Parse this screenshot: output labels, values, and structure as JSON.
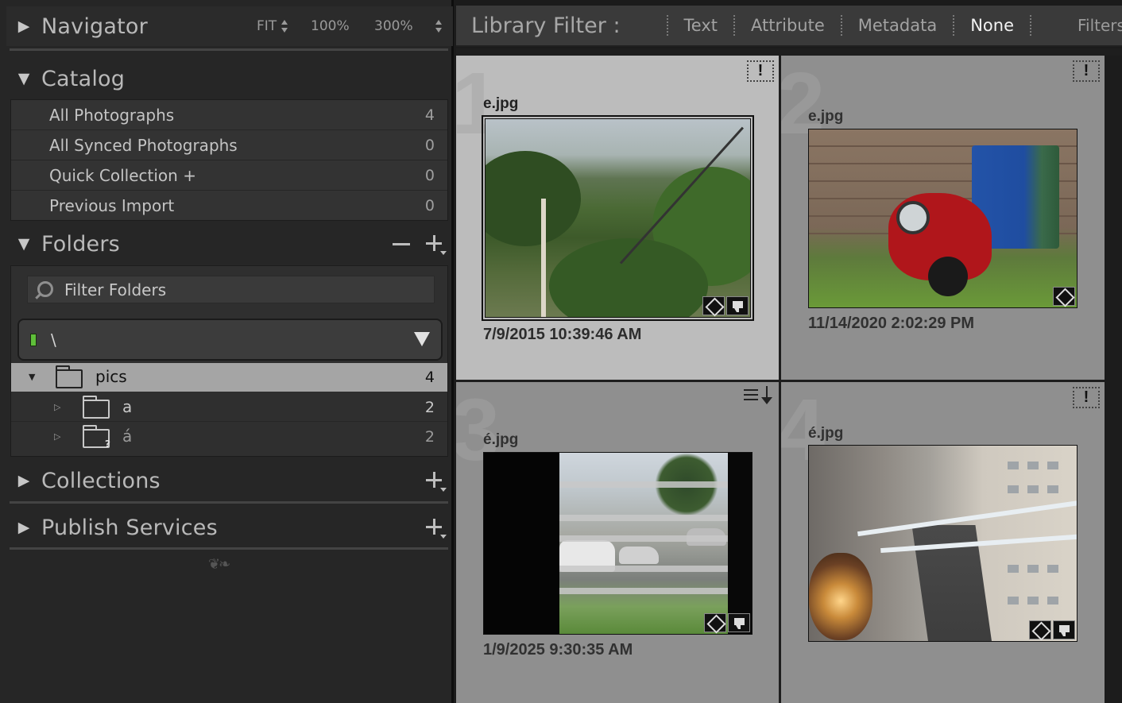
{
  "navigator": {
    "title": "Navigator",
    "zoom_fit": "FIT",
    "zoom_100": "100%",
    "zoom_300": "300%"
  },
  "catalog": {
    "title": "Catalog",
    "items": [
      {
        "label": "All Photographs",
        "count": "4"
      },
      {
        "label": "All Synced Photographs",
        "count": "0"
      },
      {
        "label": "Quick Collection  +",
        "count": "0"
      },
      {
        "label": "Previous Import",
        "count": "0"
      }
    ]
  },
  "folders": {
    "title": "Folders",
    "filter_placeholder": "Filter Folders",
    "volume_name": "\\",
    "tree": [
      {
        "label": "pics",
        "count": "4"
      },
      {
        "label": "a",
        "count": "2"
      },
      {
        "label": "á",
        "count": "2"
      }
    ]
  },
  "collections": {
    "title": "Collections"
  },
  "publish_services": {
    "title": "Publish Services"
  },
  "library_filter": {
    "label": "Library Filter :",
    "tabs": [
      "Text",
      "Attribute",
      "Metadata",
      "None"
    ],
    "active_tab": "None",
    "filters_off": "Filters Off"
  },
  "grid": {
    "cells": [
      {
        "index": "1",
        "filename": "e.jpg",
        "date": "7/9/2015 10:39:46 AM",
        "flag": "!"
      },
      {
        "index": "2",
        "filename": "e.jpg",
        "date": "11/14/2020 2:02:29 PM",
        "flag": "!"
      },
      {
        "index": "3",
        "filename": "é.jpg",
        "date": "1/9/2025 9:30:35 AM",
        "flag": ""
      },
      {
        "index": "4",
        "filename": "é.jpg",
        "date": "",
        "flag": "!"
      }
    ]
  },
  "colors": {
    "panel_bg": "#262626",
    "selected_folder": "#a5a5a5",
    "selected_cell": "#bcbcbc",
    "cell_bg": "#8f8f8f",
    "volume_light": "#5fbf3a"
  }
}
